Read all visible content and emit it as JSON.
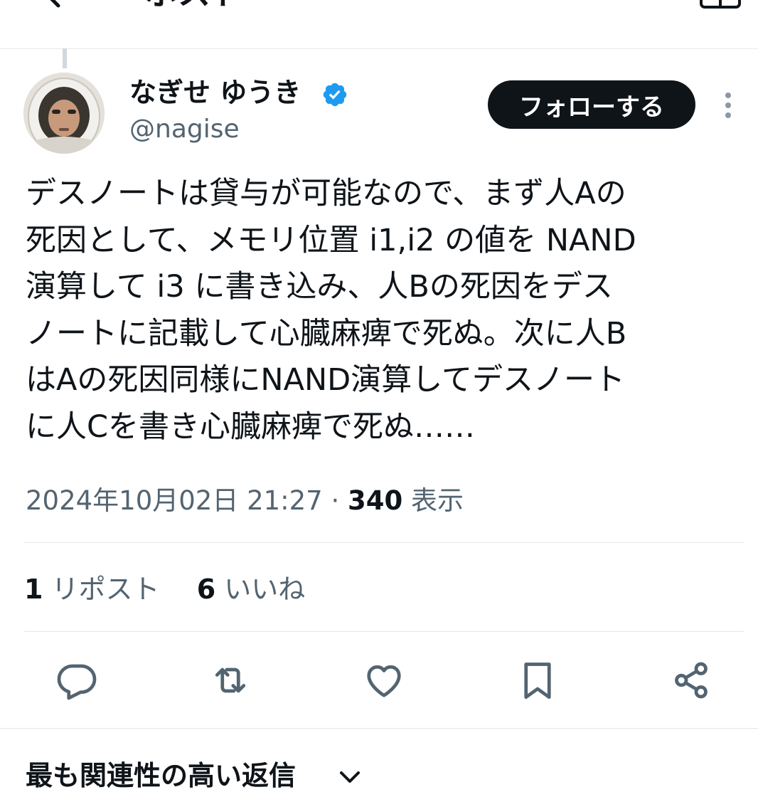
{
  "header": {
    "title": "ポスト"
  },
  "author": {
    "display_name": "なぎせ ゆうき",
    "handle": "@nagise",
    "verified": true,
    "verified_color": "#1d9bf0"
  },
  "follow_button": {
    "label": "フォローする"
  },
  "tweet": {
    "lines": [
      "デスノートは貸与が可能なので、まず人Aの",
      "死因として、メモリ位置 i1,i2 の値を NAND",
      "演算して i3 に書き込み、人Bの死因をデス",
      "ノートに記載して心臓麻痺で死ぬ。次に人B",
      "はAの死因同様にNAND演算してデスノート",
      "に人Cを書き心臓麻痺で死ぬ……"
    ],
    "timestamp": "2024年10月02日 21:27",
    "separator": "·",
    "views_count": "340",
    "views_label": "表示"
  },
  "stats": {
    "reposts_count": "1",
    "reposts_label": "リポスト",
    "likes_count": "6",
    "likes_label": "いいね"
  },
  "actions": [
    {
      "icon": "reply-icon"
    },
    {
      "icon": "repost-icon"
    },
    {
      "icon": "like-icon"
    },
    {
      "icon": "bookmark-icon"
    },
    {
      "icon": "share-icon"
    }
  ],
  "replies": {
    "sort_label": "最も関連性の高い返信"
  },
  "colors": {
    "text": "#0f1419",
    "secondary": "#536471",
    "button_bg": "#0f1419",
    "button_text": "#ffffff",
    "divider": "#e3e7ea",
    "thread_line": "#cfd9de"
  }
}
